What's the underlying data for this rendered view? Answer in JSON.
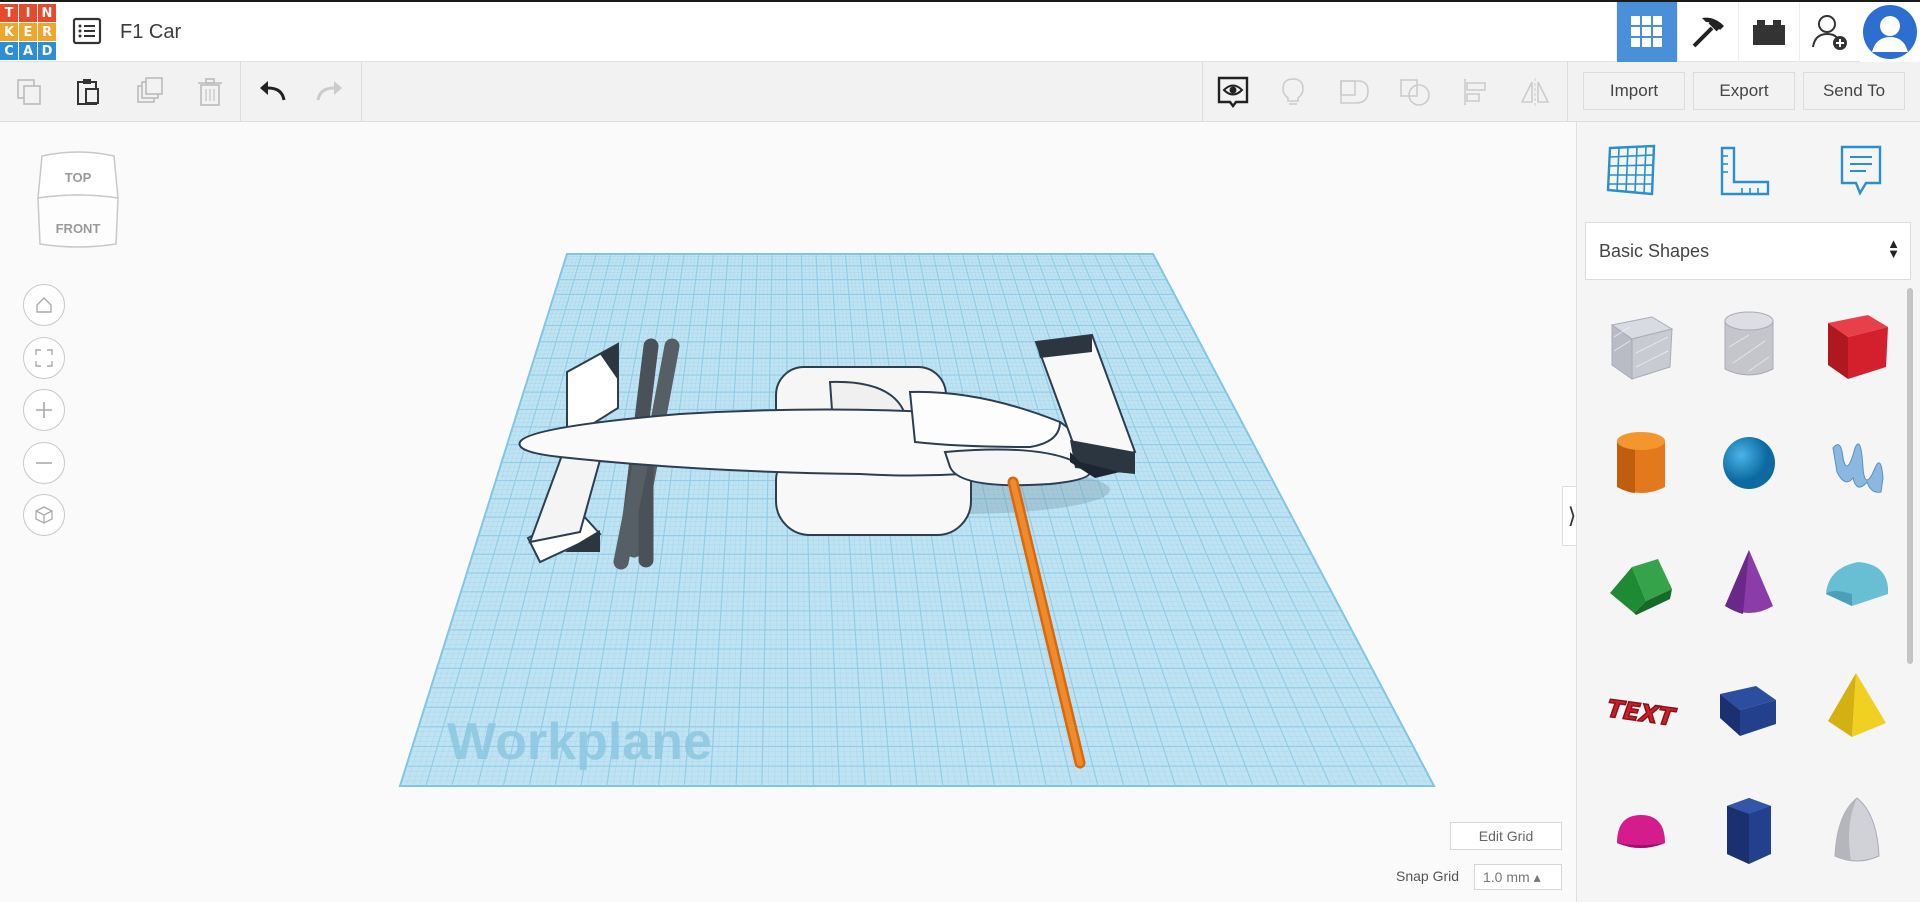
{
  "app": {
    "logo_letters": [
      "T",
      "I",
      "N",
      "K",
      "E",
      "R",
      "C",
      "A",
      "D"
    ],
    "logo_colors": [
      "#e8492c",
      "#e8492c",
      "#e8492c",
      "#f0a52c",
      "#f0a52c",
      "#f0a52c",
      "#2c8fd6",
      "#2c8fd6",
      "#2c8fd6"
    ],
    "title": "F1 Car"
  },
  "topbar": {
    "icons": [
      "3d-design-icon",
      "codeblocks-pickaxe-icon",
      "bricks-icon",
      "invite-user-icon",
      "profile-avatar-icon"
    ],
    "active_color": "#4a90d9"
  },
  "toolbar": {
    "import_label": "Import",
    "export_label": "Export",
    "send_to_label": "Send To"
  },
  "viewcube": {
    "top_label": "TOP",
    "front_label": "FRONT"
  },
  "workplane": {
    "label": "Workplane",
    "color": "#bfe3f2",
    "grid_color": "#8fcbe6"
  },
  "grid": {
    "edit_grid_label": "Edit Grid",
    "snap_label": "Snap Grid",
    "snap_value": "1.0 mm ▴"
  },
  "panel": {
    "category": "Basic Shapes",
    "shapes": [
      {
        "name": "box-hole",
        "color": "#b9bcc4"
      },
      {
        "name": "cylinder-hole",
        "color": "#c4c6cc"
      },
      {
        "name": "box",
        "color": "#d4202c"
      },
      {
        "name": "cylinder",
        "color": "#e4781c"
      },
      {
        "name": "sphere",
        "color": "#1c8cc8"
      },
      {
        "name": "scribble",
        "color": "#8ab8e0"
      },
      {
        "name": "roof",
        "color": "#34a34a"
      },
      {
        "name": "cone",
        "color": "#8a3ca8"
      },
      {
        "name": "round-roof",
        "color": "#68bfd4"
      },
      {
        "name": "text",
        "color": "#cc2028"
      },
      {
        "name": "wedge",
        "color": "#22408c"
      },
      {
        "name": "pyramid",
        "color": "#e8c81c"
      },
      {
        "name": "half-sphere",
        "color": "#d41c8c"
      },
      {
        "name": "polygon",
        "color": "#22408c"
      },
      {
        "name": "paraboloid",
        "color": "#d0d2d8"
      }
    ],
    "text_shape_label": "TEXT"
  }
}
